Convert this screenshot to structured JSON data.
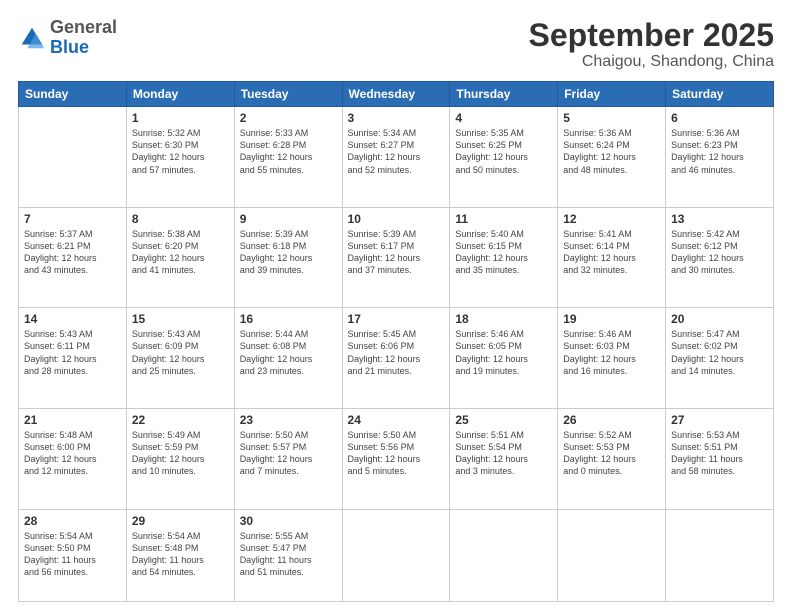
{
  "logo": {
    "general": "General",
    "blue": "Blue"
  },
  "header": {
    "month": "September 2025",
    "location": "Chaigou, Shandong, China"
  },
  "days_of_week": [
    "Sunday",
    "Monday",
    "Tuesday",
    "Wednesday",
    "Thursday",
    "Friday",
    "Saturday"
  ],
  "weeks": [
    [
      {
        "day": "",
        "info": ""
      },
      {
        "day": "1",
        "info": "Sunrise: 5:32 AM\nSunset: 6:30 PM\nDaylight: 12 hours\nand 57 minutes."
      },
      {
        "day": "2",
        "info": "Sunrise: 5:33 AM\nSunset: 6:28 PM\nDaylight: 12 hours\nand 55 minutes."
      },
      {
        "day": "3",
        "info": "Sunrise: 5:34 AM\nSunset: 6:27 PM\nDaylight: 12 hours\nand 52 minutes."
      },
      {
        "day": "4",
        "info": "Sunrise: 5:35 AM\nSunset: 6:25 PM\nDaylight: 12 hours\nand 50 minutes."
      },
      {
        "day": "5",
        "info": "Sunrise: 5:36 AM\nSunset: 6:24 PM\nDaylight: 12 hours\nand 48 minutes."
      },
      {
        "day": "6",
        "info": "Sunrise: 5:36 AM\nSunset: 6:23 PM\nDaylight: 12 hours\nand 46 minutes."
      }
    ],
    [
      {
        "day": "7",
        "info": "Sunrise: 5:37 AM\nSunset: 6:21 PM\nDaylight: 12 hours\nand 43 minutes."
      },
      {
        "day": "8",
        "info": "Sunrise: 5:38 AM\nSunset: 6:20 PM\nDaylight: 12 hours\nand 41 minutes."
      },
      {
        "day": "9",
        "info": "Sunrise: 5:39 AM\nSunset: 6:18 PM\nDaylight: 12 hours\nand 39 minutes."
      },
      {
        "day": "10",
        "info": "Sunrise: 5:39 AM\nSunset: 6:17 PM\nDaylight: 12 hours\nand 37 minutes."
      },
      {
        "day": "11",
        "info": "Sunrise: 5:40 AM\nSunset: 6:15 PM\nDaylight: 12 hours\nand 35 minutes."
      },
      {
        "day": "12",
        "info": "Sunrise: 5:41 AM\nSunset: 6:14 PM\nDaylight: 12 hours\nand 32 minutes."
      },
      {
        "day": "13",
        "info": "Sunrise: 5:42 AM\nSunset: 6:12 PM\nDaylight: 12 hours\nand 30 minutes."
      }
    ],
    [
      {
        "day": "14",
        "info": "Sunrise: 5:43 AM\nSunset: 6:11 PM\nDaylight: 12 hours\nand 28 minutes."
      },
      {
        "day": "15",
        "info": "Sunrise: 5:43 AM\nSunset: 6:09 PM\nDaylight: 12 hours\nand 25 minutes."
      },
      {
        "day": "16",
        "info": "Sunrise: 5:44 AM\nSunset: 6:08 PM\nDaylight: 12 hours\nand 23 minutes."
      },
      {
        "day": "17",
        "info": "Sunrise: 5:45 AM\nSunset: 6:06 PM\nDaylight: 12 hours\nand 21 minutes."
      },
      {
        "day": "18",
        "info": "Sunrise: 5:46 AM\nSunset: 6:05 PM\nDaylight: 12 hours\nand 19 minutes."
      },
      {
        "day": "19",
        "info": "Sunrise: 5:46 AM\nSunset: 6:03 PM\nDaylight: 12 hours\nand 16 minutes."
      },
      {
        "day": "20",
        "info": "Sunrise: 5:47 AM\nSunset: 6:02 PM\nDaylight: 12 hours\nand 14 minutes."
      }
    ],
    [
      {
        "day": "21",
        "info": "Sunrise: 5:48 AM\nSunset: 6:00 PM\nDaylight: 12 hours\nand 12 minutes."
      },
      {
        "day": "22",
        "info": "Sunrise: 5:49 AM\nSunset: 5:59 PM\nDaylight: 12 hours\nand 10 minutes."
      },
      {
        "day": "23",
        "info": "Sunrise: 5:50 AM\nSunset: 5:57 PM\nDaylight: 12 hours\nand 7 minutes."
      },
      {
        "day": "24",
        "info": "Sunrise: 5:50 AM\nSunset: 5:56 PM\nDaylight: 12 hours\nand 5 minutes."
      },
      {
        "day": "25",
        "info": "Sunrise: 5:51 AM\nSunset: 5:54 PM\nDaylight: 12 hours\nand 3 minutes."
      },
      {
        "day": "26",
        "info": "Sunrise: 5:52 AM\nSunset: 5:53 PM\nDaylight: 12 hours\nand 0 minutes."
      },
      {
        "day": "27",
        "info": "Sunrise: 5:53 AM\nSunset: 5:51 PM\nDaylight: 11 hours\nand 58 minutes."
      }
    ],
    [
      {
        "day": "28",
        "info": "Sunrise: 5:54 AM\nSunset: 5:50 PM\nDaylight: 11 hours\nand 56 minutes."
      },
      {
        "day": "29",
        "info": "Sunrise: 5:54 AM\nSunset: 5:48 PM\nDaylight: 11 hours\nand 54 minutes."
      },
      {
        "day": "30",
        "info": "Sunrise: 5:55 AM\nSunset: 5:47 PM\nDaylight: 11 hours\nand 51 minutes."
      },
      {
        "day": "",
        "info": ""
      },
      {
        "day": "",
        "info": ""
      },
      {
        "day": "",
        "info": ""
      },
      {
        "day": "",
        "info": ""
      }
    ]
  ]
}
